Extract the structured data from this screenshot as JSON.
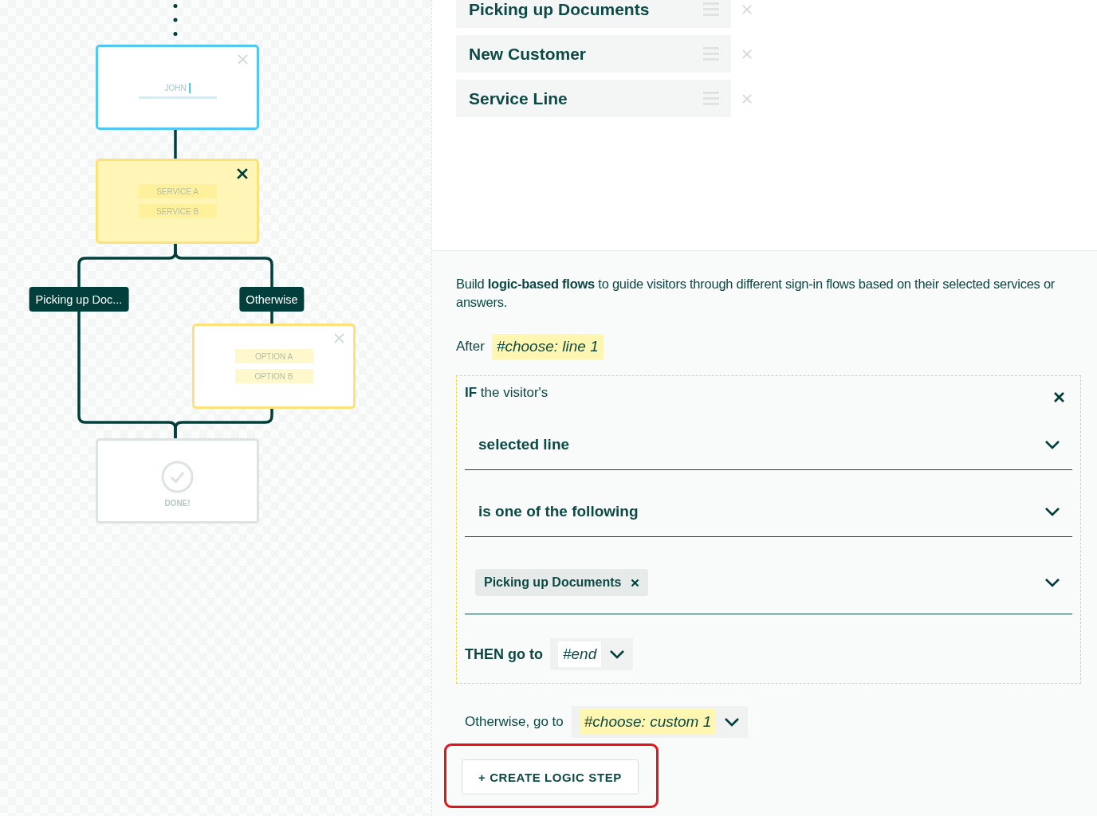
{
  "flow_canvas": {
    "nodes": [
      {
        "kind": "input",
        "value": "JOHN",
        "selected": false
      },
      {
        "kind": "choice",
        "options": [
          "SERVICE A",
          "SERVICE B"
        ],
        "selected": true
      },
      {
        "kind": "choice",
        "options": [
          "OPTION A",
          "OPTION B"
        ],
        "selected": false
      },
      {
        "kind": "end",
        "label": "DONE!",
        "selected": false
      }
    ],
    "branch_labels": [
      "Picking up Doc...",
      "Otherwise"
    ]
  },
  "lines": [
    "Picking up Documents",
    "New Customer",
    "Service Line"
  ],
  "description": "Build **logic-based flows** to guide visitors through different sign-in flows based on their selected services or answers.",
  "after": {
    "label": "After",
    "target": "#choose: line 1"
  },
  "rule": {
    "heading": "**IF** the visitor's",
    "conditions": [
      {
        "kind": "select",
        "value": "selected line"
      },
      {
        "kind": "select",
        "value": "is one of the following"
      },
      {
        "kind": "tags",
        "tags": [
          "Picking up Documents"
        ]
      }
    ],
    "then": {
      "label": "THEN go to",
      "target": "#end",
      "highlighted": false
    }
  },
  "otherwise": {
    "label": "Otherwise, go to",
    "target": "#choose: custom 1",
    "highlighted": true
  },
  "create_button": {
    "label": "+ CREATE LOGIC STEP",
    "highlighted": true
  }
}
